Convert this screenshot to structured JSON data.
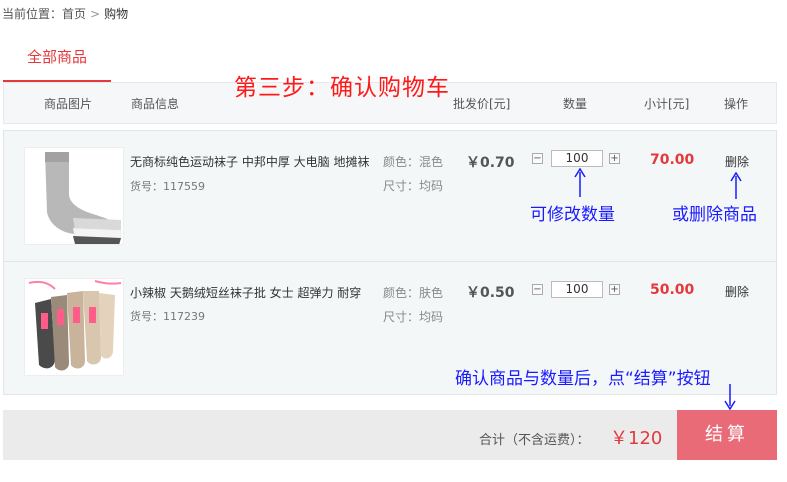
{
  "breadcrumb": {
    "prefix": "当前位置：",
    "home": "首页",
    "separator": ">",
    "current": "购物"
  },
  "tabs": [
    {
      "label": "全部商品"
    }
  ],
  "step_title": "第三步：确认购物车",
  "table_header": {
    "image": "商品图片",
    "info": "商品信息",
    "price": "批发价[元]",
    "quantity": "数量",
    "subtotal": "小计[元]",
    "action": "操作"
  },
  "items": [
    {
      "name": "无商标纯色运动袜子 中邦中厚 大电脑 地摊袜",
      "code": "货号：117559",
      "color": "颜色：混色",
      "size": "尺寸：均码",
      "price": "￥0.70",
      "quantity": "100",
      "subtotal": "70.00",
      "delete": "删除"
    },
    {
      "name": "小辣椒 天鹅绒短丝袜子批 女士 超弹力 耐穿",
      "code": "货号：117239",
      "color": "颜色：肤色",
      "size": "尺寸：均码",
      "price": "￥0.50",
      "quantity": "100",
      "subtotal": "50.00",
      "delete": "删除"
    }
  ],
  "annotations": {
    "quantity_hint": "可修改数量",
    "delete_hint": "或删除商品",
    "checkout_hint": "确认商品与数量后，点“结算”按钮"
  },
  "footer": {
    "total_label": "合计（不含运费）：",
    "total_value": "￥120",
    "checkout_label": "结算"
  },
  "colors": {
    "accent_red": "#e4393c",
    "checkout_bg": "#e96b77",
    "annotation_blue": "#1a1aff",
    "step_red": "#ff1a1a"
  }
}
